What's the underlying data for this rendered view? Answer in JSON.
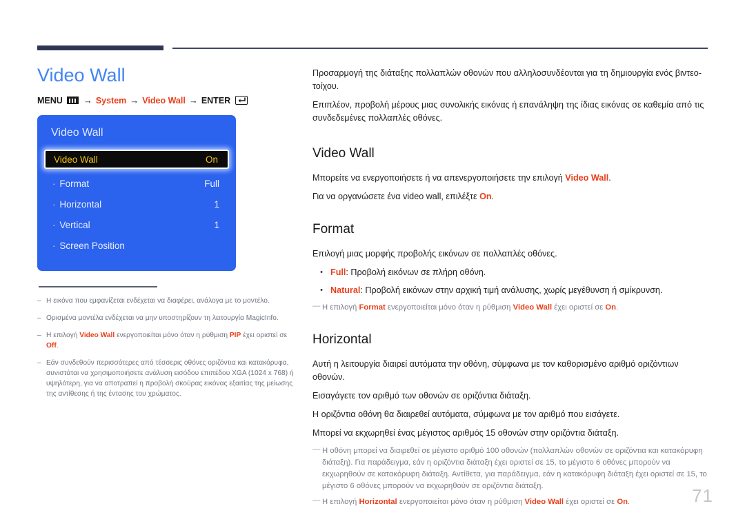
{
  "document": {
    "page_number": "71"
  },
  "left": {
    "title": "Video Wall",
    "menu_path": {
      "menu_label": "MENU",
      "menu_icon": "menu-grid-icon",
      "arrow": "→",
      "step1": "System",
      "step2": "Video Wall",
      "enter_label": "ENTER",
      "enter_icon": "enter-return-icon"
    },
    "osd": {
      "title": "Video Wall",
      "rows": [
        {
          "label": "Video Wall",
          "value": "On",
          "selected": true,
          "bullet": ""
        },
        {
          "label": "Format",
          "value": "Full",
          "selected": false,
          "bullet": "·"
        },
        {
          "label": "Horizontal",
          "value": "1",
          "selected": false,
          "bullet": "·"
        },
        {
          "label": "Vertical",
          "value": "1",
          "selected": false,
          "bullet": "·"
        },
        {
          "label": "Screen Position",
          "value": "",
          "selected": false,
          "bullet": "·"
        }
      ]
    },
    "notes": [
      {
        "dash": "‒",
        "html": "Η εικόνα που εμφανίζεται ενδέχεται να διαφέρει, ανάλογα με το μοντέλο."
      },
      {
        "dash": "‒",
        "html": "Ορισμένα μοντέλα ενδέχεται να μην υποστηρίζουν τη λειτουργία MagicInfo."
      },
      {
        "dash": "‒",
        "html": "Η επιλογή <b>Video Wall</b> ενεργοποιείται μόνο όταν η ρύθμιση <b>PIP</b> έχει οριστεί σε <b>Off</b>."
      },
      {
        "dash": "‒",
        "html": "Εάν συνδεθούν περισσότερες από τέσσερις οθόνες οριζόντια και κατακόρυφα, συνιστάται να χρησιμοποιήσετε ανάλυση εισόδου επιπέδου XGA (1024 x 768) ή υψηλότερη, για να αποτραπεί η προβολή σκούρας εικόνας εξαιτίας της μείωσης της αντίθεσης ή της έντασης του χρώματος."
      }
    ]
  },
  "right": {
    "intro": [
      "Προσαρμογή της διάταξης πολλαπλών οθονών που αλληλοσυνδέονται για τη δημιουργία ενός βιντεο-τοίχου.",
      "Επιπλέον, προβολή μέρους μιας συνολικής εικόνας ή επανάληψη της ίδιας εικόνας σε καθεμία από τις συνδεδεμένες πολλαπλές οθόνες."
    ],
    "sections": [
      {
        "heading": "Video Wall",
        "paragraphs": [
          "Μπορείτε να ενεργοποιήσετε ή να απενεργοποιήσετε την επιλογή <span class=\"red-i\">Video Wall</span>.",
          "Για να οργανώσετε ένα video wall, επιλέξτε <span class=\"red-i\">On</span>."
        ],
        "bullets": [],
        "notes": []
      },
      {
        "heading": "Format",
        "paragraphs": [
          "Επιλογή μιας μορφής προβολής εικόνων σε πολλαπλές οθόνες."
        ],
        "bullets": [
          {
            "marker": "•",
            "html": "<span class=\"red-i\">Full</span>: Προβολή εικόνων σε πλήρη οθόνη."
          },
          {
            "marker": "•",
            "html": "<span class=\"red-i\">Natural</span>: Προβολή εικόνων στην αρχική τιμή ανάλυσης, χωρίς μεγέθυνση ή σμίκρυνση."
          }
        ],
        "notes": [
          {
            "dash": "―",
            "html": "Η επιλογή <b>Format</b> ενεργοποιείται μόνο όταν η ρύθμιση <b>Video Wall</b> έχει οριστεί σε <b>On</b>."
          }
        ]
      },
      {
        "heading": "Horizontal",
        "paragraphs": [
          "Αυτή η λειτουργία διαιρεί αυτόματα την οθόνη, σύμφωνα με τον καθορισμένο αριθμό οριζόντιων οθονών.",
          "Εισαγάγετε τον αριθμό των οθονών σε οριζόντια διάταξη.",
          "Η οριζόντια οθόνη θα διαιρεθεί αυτόματα, σύμφωνα με τον αριθμό που εισάγετε.",
          "Μπορεί να εκχωρηθεί ένας μέγιστος αριθμός 15 οθονών στην οριζόντια διάταξη."
        ],
        "bullets": [],
        "notes": [
          {
            "dash": "―",
            "html": "Η οθόνη μπορεί να διαιρεθεί σε μέγιστο αριθμό 100 οθονών (πολλαπλών οθονών σε οριζόντια και κατακόρυφη διάταξη). Για παράδειγμα, εάν η οριζόντια διάταξη έχει οριστεί σε 15, το μέγιστο 6 οθόνες μπορούν να εκχωρηθούν σε κατακόρυφη διάταξη. Αντίθετα, για παράδειγμα, εάν η κατακόρυφη διάταξη έχει οριστεί σε 15, το μέγιστο 6 οθόνες μπορούν να εκχωρηθούν σε οριζόντια διάταξη."
          },
          {
            "dash": "―",
            "html": "Η επιλογή <b>Horizontal</b> ενεργοποιείται μόνο όταν η ρύθμιση <b>Video Wall</b> έχει οριστεί σε <b>On</b>."
          }
        ]
      }
    ]
  },
  "colors": {
    "accent_blue": "#4285f4",
    "osd_blue": "#2b62ee",
    "highlight_text": "#f5c518",
    "red": "#e8401c",
    "rule_navy": "#2e3653"
  }
}
